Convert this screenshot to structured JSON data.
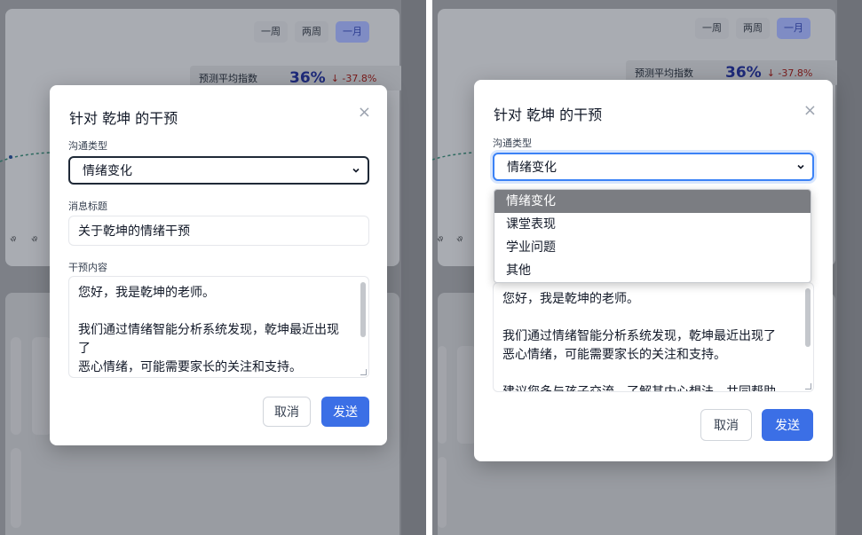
{
  "background": {
    "range_buttons": [
      "一周",
      "两周",
      "一月"
    ],
    "active_range": "一月",
    "stat_label": "预测平均指数",
    "stat_value": "36%",
    "stat_delta": "↓ -37.8%",
    "axis_ticks": [
      "ゅ",
      "ゅ"
    ]
  },
  "modal": {
    "title": "针对 乾坤 的干预",
    "close_glyph": "×",
    "comm_type_label": "沟通类型",
    "comm_type_value": "情绪变化",
    "comm_type_options": [
      "情绪变化",
      "课堂表现",
      "学业问题",
      "其他"
    ],
    "subject_label": "消息标题",
    "subject_value": "关于乾坤的情绪干预",
    "content_label": "干预内容",
    "content_lines": [
      "您好，我是乾坤的老师。",
      "",
      "我们通过情绪智能分析系统发现，乾坤最近出现了",
      "恶心情绪，可能需要家长的关注和支持。",
      "",
      "建议您多与孩子交流，了解其内心想法，共同帮助"
    ],
    "cancel_label": "取消",
    "send_label": "发送"
  },
  "colors": {
    "primary": "#3b6fe6",
    "focus_ring": "#3b82f6",
    "delta_red": "#dc2626",
    "stat_blue": "#1e2a7a"
  }
}
